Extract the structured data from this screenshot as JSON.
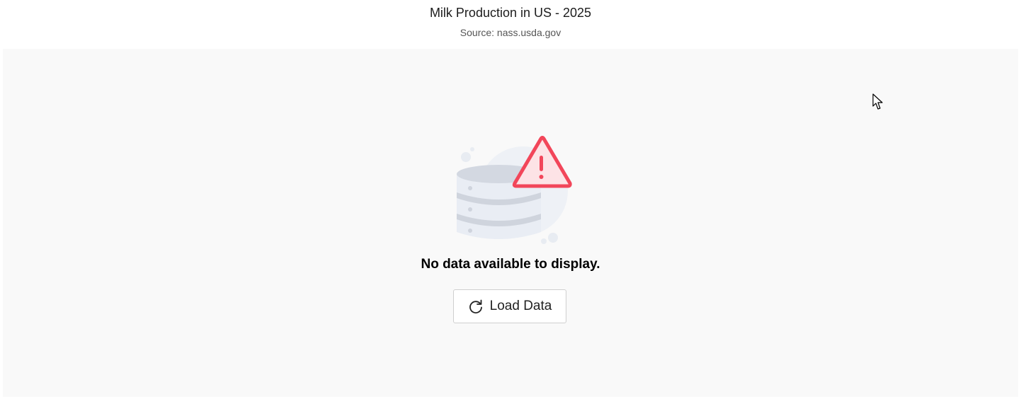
{
  "header": {
    "title": "Milk Production in US - 2025",
    "subtitle": "Source: nass.usda.gov"
  },
  "empty_state": {
    "message": "No data available to display.",
    "illustration_icon": "database-warning-icon",
    "load_button": {
      "label": "Load Data",
      "icon": "refresh-icon"
    }
  },
  "colors": {
    "panel_background": "#f9f9f9",
    "warning_red": "#f2465a",
    "database_gray": "#d4d9e2"
  }
}
